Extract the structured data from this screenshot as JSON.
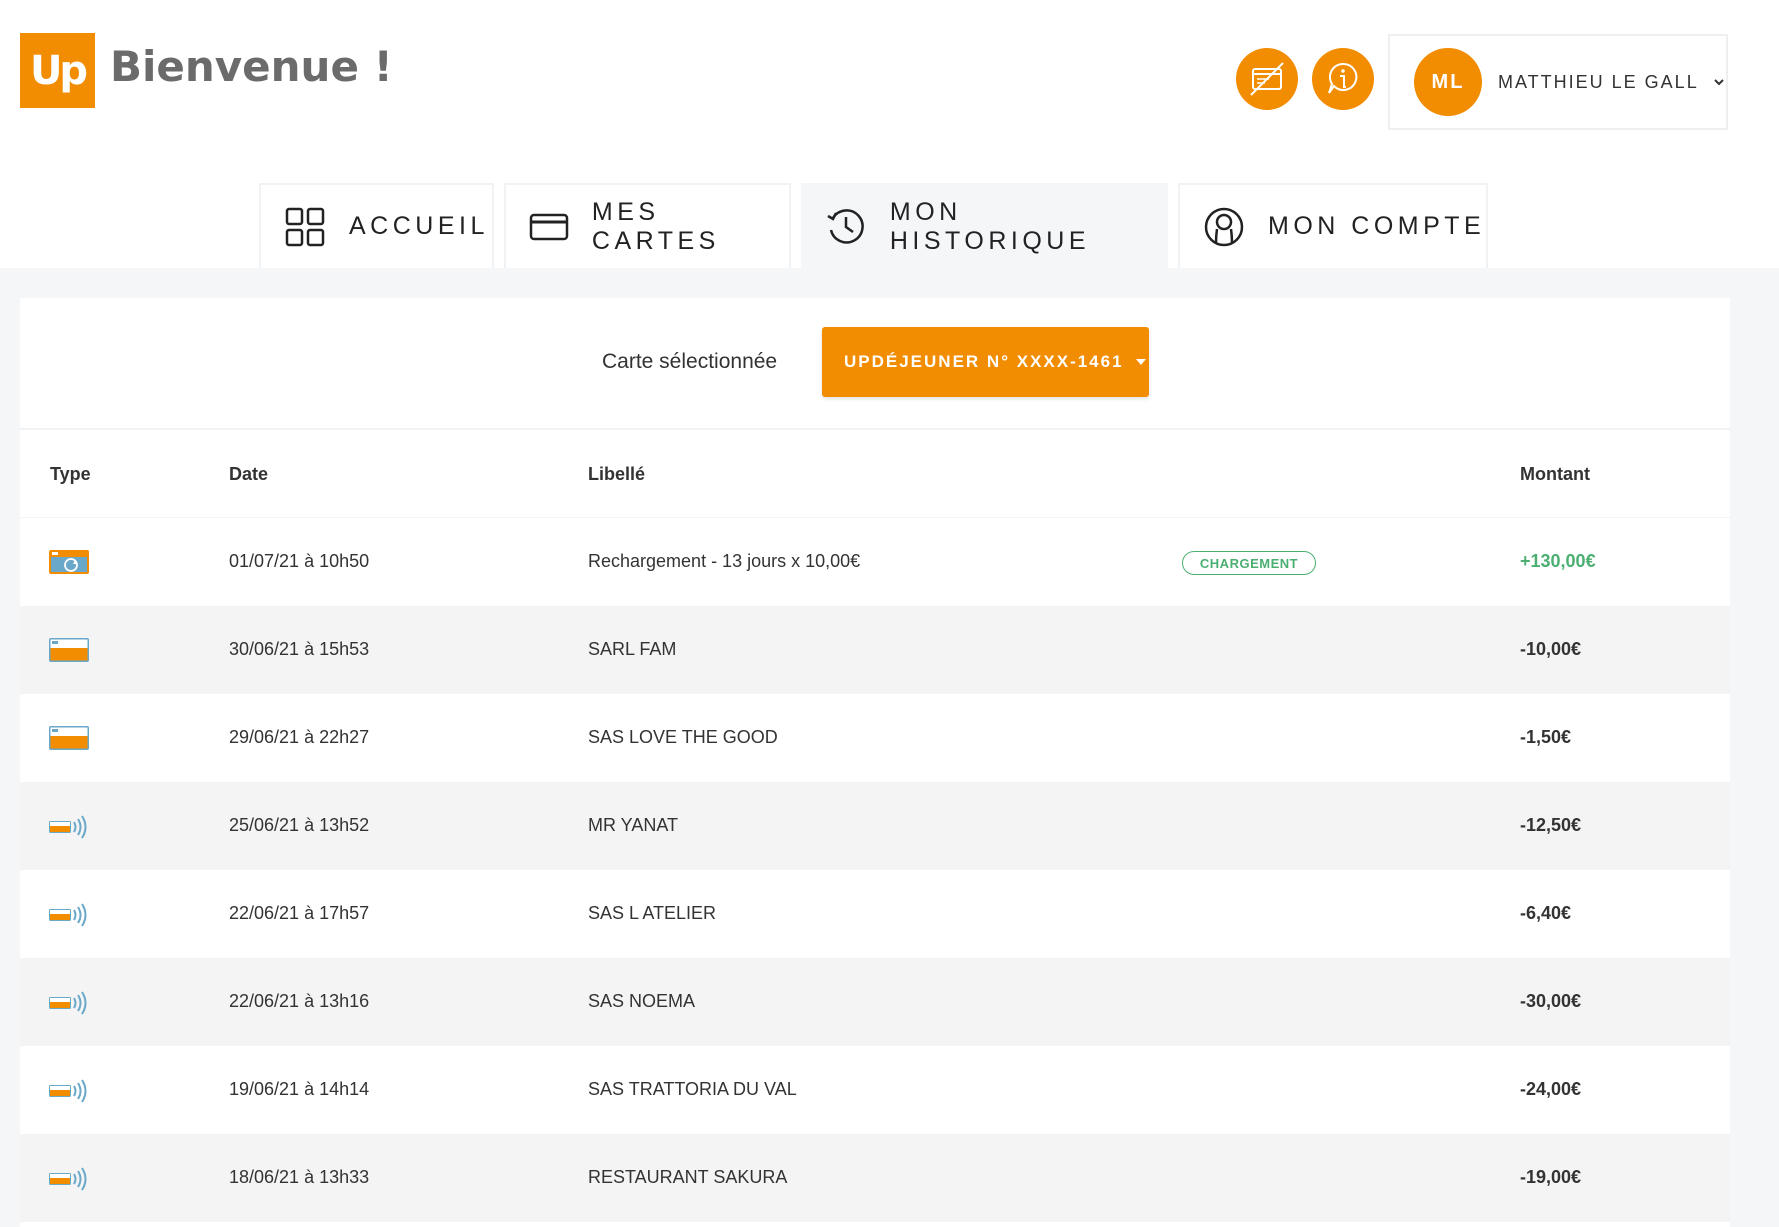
{
  "header": {
    "logo_text": "Up",
    "welcome": "Bienvenue !",
    "user": {
      "initials": "ML",
      "name": "MATTHIEU LE GALL"
    }
  },
  "tabs": [
    {
      "label": "ACCUEIL",
      "icon": "grid-icon",
      "active": false
    },
    {
      "label": "MES CARTES",
      "icon": "card-icon",
      "active": false
    },
    {
      "label": "MON HISTORIQUE",
      "icon": "history-icon",
      "active": true
    },
    {
      "label": "MON COMPTE",
      "icon": "account-icon",
      "active": false
    }
  ],
  "selector": {
    "label": "Carte sélectionnée",
    "selected": "UPDÉJEUNER N° XXXX-1461"
  },
  "table": {
    "columns": {
      "type": "Type",
      "date": "Date",
      "label": "Libellé",
      "amount": "Montant"
    },
    "rows": [
      {
        "type": "recharge",
        "date": "01/07/21 à 10h50",
        "label": "Rechargement - 13 jours x 10,00€",
        "badge": "CHARGEMENT",
        "amount": "+130,00€"
      },
      {
        "type": "card",
        "date": "30/06/21 à 15h53",
        "label": "SARL FAM",
        "amount": "-10,00€"
      },
      {
        "type": "card",
        "date": "29/06/21 à 22h27",
        "label": "SAS LOVE THE GOOD",
        "amount": "-1,50€"
      },
      {
        "type": "contactless",
        "date": "25/06/21 à 13h52",
        "label": "MR YANAT",
        "amount": "-12,50€"
      },
      {
        "type": "contactless",
        "date": "22/06/21 à 17h57",
        "label": "SAS L ATELIER",
        "amount": "-6,40€"
      },
      {
        "type": "contactless",
        "date": "22/06/21 à 13h16",
        "label": "SAS NOEMA",
        "amount": "-30,00€"
      },
      {
        "type": "contactless",
        "date": "19/06/21 à 14h14",
        "label": "SAS TRATTORIA DU VAL",
        "amount": "-24,00€"
      },
      {
        "type": "contactless",
        "date": "18/06/21 à 13h33",
        "label": "RESTAURANT SAKURA",
        "amount": "-19,00€"
      }
    ]
  },
  "colors": {
    "brand": "#f28c00",
    "positive": "#4caf72",
    "row_alt": "#f4f4f5"
  }
}
